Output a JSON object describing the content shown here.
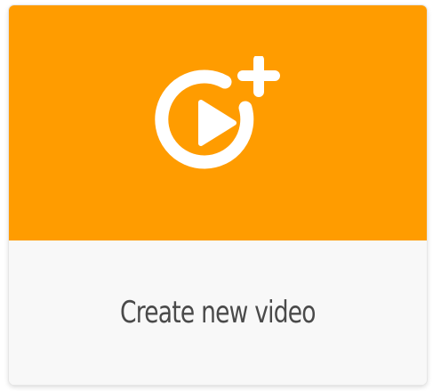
{
  "card": {
    "label": "Create new video",
    "icon": "video-add-icon",
    "colors": {
      "hero_background": "#ff9c00",
      "footer_background": "#f8f8f8",
      "icon": "#ffffff",
      "label_text": "#4a4a4a"
    }
  }
}
